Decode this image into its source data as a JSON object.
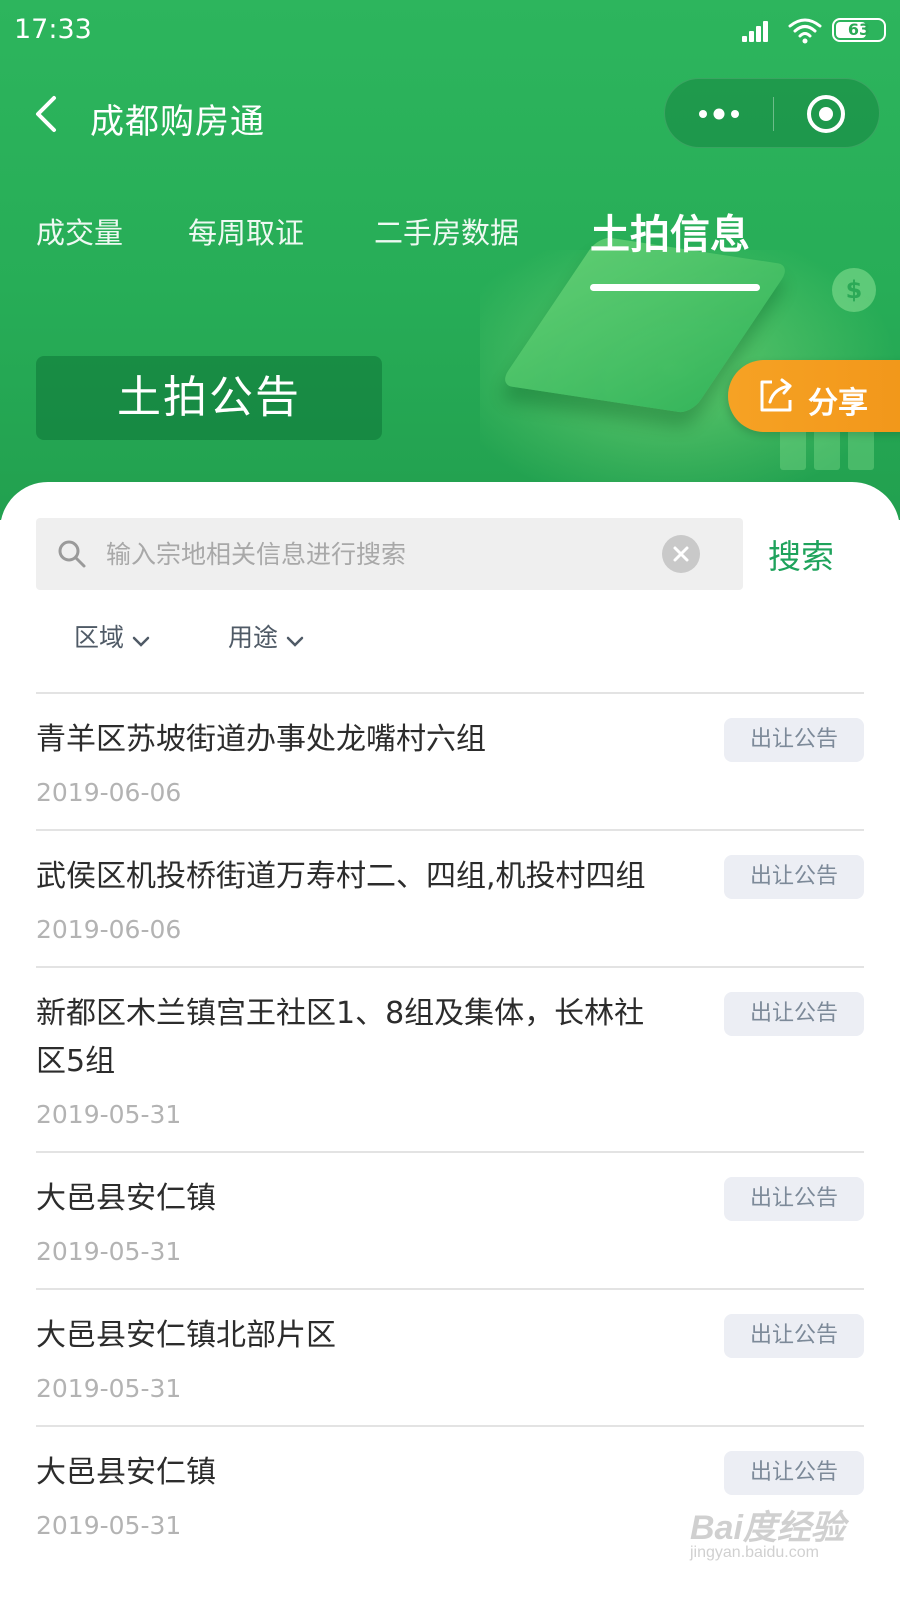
{
  "status_bar": {
    "time": "17:33",
    "battery": "63"
  },
  "nav": {
    "title": "成都购房通"
  },
  "tabs": [
    {
      "label": "成交量"
    },
    {
      "label": "每周取证"
    },
    {
      "label": "二手房数据"
    },
    {
      "label": "土拍信息",
      "active": true
    }
  ],
  "banner": {
    "title": "土拍公告",
    "share_label": "分享",
    "coin_glyph": "$"
  },
  "search": {
    "placeholder": "输入宗地相关信息进行搜索",
    "value": "",
    "button_label": "搜索"
  },
  "filters": [
    {
      "label": "区域"
    },
    {
      "label": "用途"
    }
  ],
  "listings": [
    {
      "title": "青羊区苏坡街道办事处龙嘴村六组",
      "date": "2019-06-06",
      "badge": "出让公告"
    },
    {
      "title": "武侯区机投桥街道万寿村二、四组,机投村四组",
      "date": "2019-06-06",
      "badge": "出让公告"
    },
    {
      "title": "新都区木兰镇宫王社区1、8组及集体，长林社区5组",
      "date": "2019-05-31",
      "badge": "出让公告"
    },
    {
      "title": "大邑县安仁镇",
      "date": "2019-05-31",
      "badge": "出让公告"
    },
    {
      "title": "大邑县安仁镇北部片区",
      "date": "2019-05-31",
      "badge": "出让公告"
    },
    {
      "title": "大邑县安仁镇",
      "date": "2019-05-31",
      "badge": "出让公告"
    }
  ],
  "watermark": {
    "logo": "Bai度经验",
    "url": "jingyan.baidu.com"
  },
  "colors": {
    "header_green": "#2db55d",
    "accent_green": "#1fa35c",
    "share_orange": "#f6a224",
    "badge_bg": "#eceef4"
  }
}
